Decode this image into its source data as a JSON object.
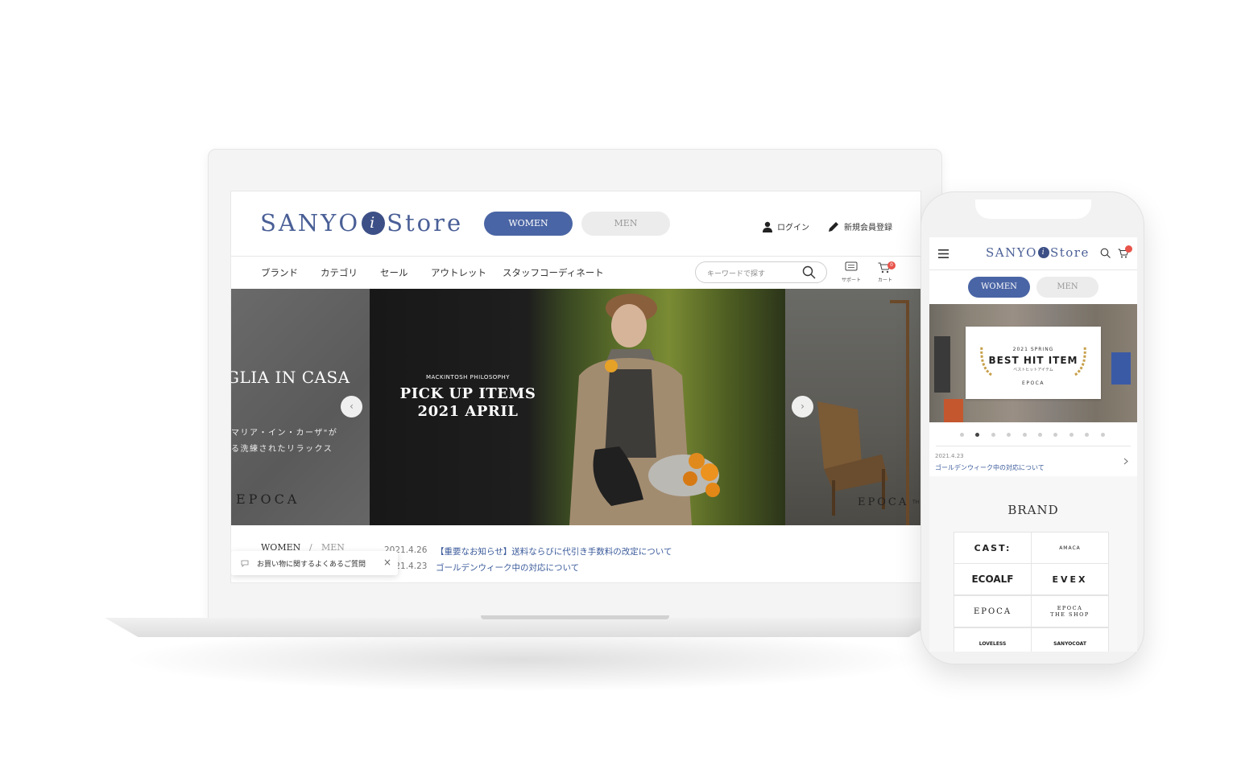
{
  "desktop": {
    "header": {
      "logo_text_left": "SANYO",
      "logo_i": "i",
      "logo_text_right": "Store",
      "gender_tabs": [
        "WOMEN",
        "MEN"
      ],
      "login": "ログイン",
      "register": "新規会員登録"
    },
    "nav": {
      "items": [
        "ブランド",
        "カテゴリ",
        "セール",
        "アウトレット",
        "スタッフコーディネート"
      ],
      "search_placeholder": "キーワードで探す",
      "support_label": "サポート",
      "cart_label": "カート",
      "cart_count": "0"
    },
    "hero": {
      "left_title": "GLIA IN CASA",
      "left_line1": "マリア・イン・カーザ\"が",
      "left_line2": "る洗練されたリラックス",
      "left_brand": "EPOCA",
      "main_kicker": "MACKINTOSH PHILOSOPHY",
      "main_title_1": "PICK UP ITEMS",
      "main_title_2": "2021 APRIL",
      "right_brand": "EPOCA",
      "right_brand_suffix": "TH",
      "prev": "‹",
      "next": "›"
    },
    "news": {
      "tabs": [
        "WOMEN",
        "/",
        "MEN"
      ],
      "items": [
        {
          "date": "2021.4.26",
          "text": "【重要なお知らせ】送料ならびに代引き手数料の改定について"
        },
        {
          "date": "2021.4.23",
          "text": "ゴールデンウィーク中の対応について"
        }
      ]
    },
    "faq": {
      "text": "お買い物に関するよくあるご質問",
      "close": "×"
    }
  },
  "mobile": {
    "logo_text_left": "SANYO",
    "logo_i": "i",
    "logo_text_right": "Store",
    "gender_tabs": [
      "WOMEN",
      "MEN"
    ],
    "banner": {
      "kicker": "2021 SPRING",
      "title": "BEST HIT ITEM",
      "sub": "ベストヒットアイテム",
      "brand": "EPOCA"
    },
    "carousel_dots": 10,
    "active_dot": 1,
    "news": {
      "date": "2021.4.23",
      "text": "ゴールデンウィーク中の対応について"
    },
    "brand_heading": "BRAND",
    "brands": [
      "CAST:",
      "AMACA",
      "ECOALF",
      "EVEX",
      "EPOCA",
      "EPOCA THE SHOP",
      "LOVELESS",
      "SANYOCOAT"
    ]
  },
  "colors": {
    "brand_blue": "#4a65a5",
    "news_link": "#3a5a9a",
    "cart_badge": "#e8534a"
  }
}
